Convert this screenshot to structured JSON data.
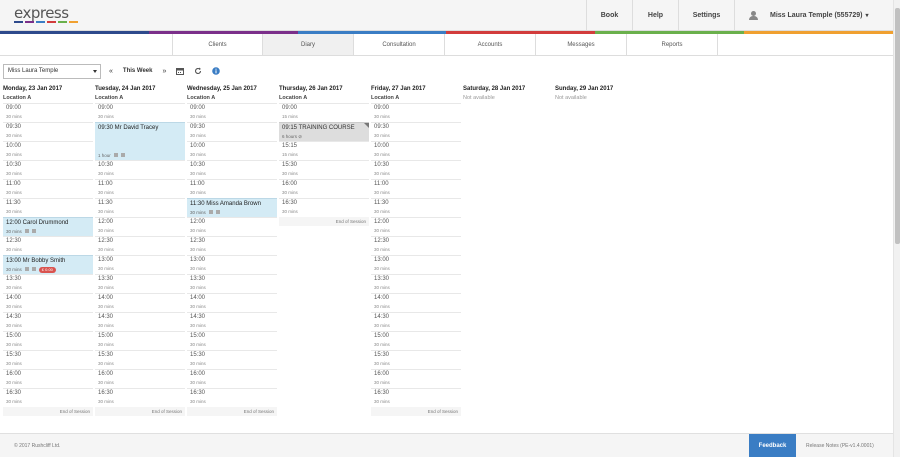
{
  "header": {
    "logo_text": "express",
    "logo_colors": [
      "#2e4a8c",
      "#7b2f8a",
      "#3a7dc4",
      "#d23c3c",
      "#6ab04c",
      "#f0a030"
    ],
    "nav": [
      {
        "label": "Book"
      },
      {
        "label": "Help"
      },
      {
        "label": "Settings"
      }
    ],
    "user": {
      "name": "Miss Laura Temple (555729)",
      "caret": "▾"
    }
  },
  "rainbow_colors": [
    "#2e4a8c",
    "#7b2f8a",
    "#3a7dc4",
    "#d23c3c",
    "#6ab04c",
    "#f0a030"
  ],
  "tabs": [
    {
      "label": "Clients",
      "active": false
    },
    {
      "label": "Diary",
      "active": true
    },
    {
      "label": "Consultation",
      "active": false
    },
    {
      "label": "Accounts",
      "active": false
    },
    {
      "label": "Messages",
      "active": false
    },
    {
      "label": "Reports",
      "active": false
    }
  ],
  "toolbar": {
    "practitioner": "Miss Laura Temple",
    "prev": "«",
    "week_label": "This Week",
    "next": "»",
    "calendar_icon": "calendar-icon",
    "refresh_icon": "refresh-icon",
    "info_icon": "info-icon"
  },
  "diary": {
    "days": [
      {
        "title": "Monday, 23 Jan 2017",
        "location": "Location A",
        "slots": [
          [
            "09:00",
            "30 mins"
          ],
          [
            "09:30",
            "30 mins"
          ],
          [
            "10:00",
            "30 mins"
          ],
          [
            "10:30",
            "30 mins"
          ],
          [
            "11:00",
            "30 mins"
          ],
          [
            "11:30",
            "30 mins"
          ],
          [
            "12:00 Carol Drummond",
            "30 mins",
            "appt"
          ],
          [
            "12:30",
            "30 mins"
          ],
          [
            "13:00 Mr Bobby Smith",
            "30 mins",
            "appt",
            "£ 0.00"
          ],
          [
            "13:30",
            "30 mins"
          ],
          [
            "14:00",
            "30 mins"
          ],
          [
            "14:30",
            "30 mins"
          ],
          [
            "15:00",
            "30 mins"
          ],
          [
            "15:30",
            "30 mins"
          ],
          [
            "16:00",
            "30 mins"
          ],
          [
            "16:30",
            "30 mins"
          ]
        ],
        "end": "End of Session"
      },
      {
        "title": "Tuesday, 24 Jan 2017",
        "location": "Location A",
        "slots": [
          [
            "09:00",
            "30 mins"
          ],
          [
            "09:30 Mr David Tracey",
            "1 hour",
            "appt2"
          ],
          [
            "10:30",
            "30 mins"
          ],
          [
            "11:00",
            "30 mins"
          ],
          [
            "11:30",
            "30 mins"
          ],
          [
            "12:00",
            "30 mins"
          ],
          [
            "12:30",
            "30 mins"
          ],
          [
            "13:00",
            "30 mins"
          ],
          [
            "13:30",
            "30 mins"
          ],
          [
            "14:00",
            "30 mins"
          ],
          [
            "14:30",
            "30 mins"
          ],
          [
            "15:00",
            "30 mins"
          ],
          [
            "15:30",
            "30 mins"
          ],
          [
            "16:00",
            "30 mins"
          ],
          [
            "16:30",
            "30 mins"
          ]
        ],
        "end": "End of Session"
      },
      {
        "title": "Wednesday, 25 Jan 2017",
        "location": "Location A",
        "slots": [
          [
            "09:00",
            "30 mins"
          ],
          [
            "09:30",
            "30 mins"
          ],
          [
            "10:00",
            "30 mins"
          ],
          [
            "10:30",
            "30 mins"
          ],
          [
            "11:00",
            "30 mins"
          ],
          [
            "11:30 Miss Amanda Brown",
            "30 mins",
            "appt"
          ],
          [
            "12:00",
            "30 mins"
          ],
          [
            "12:30",
            "30 mins"
          ],
          [
            "13:00",
            "30 mins"
          ],
          [
            "13:30",
            "30 mins"
          ],
          [
            "14:00",
            "30 mins"
          ],
          [
            "14:30",
            "30 mins"
          ],
          [
            "15:00",
            "30 mins"
          ],
          [
            "15:30",
            "30 mins"
          ],
          [
            "16:00",
            "30 mins"
          ],
          [
            "16:30",
            "30 mins"
          ]
        ],
        "end": "End of Session"
      },
      {
        "title": "Thursday, 26 Jan 2017",
        "location": "Location A",
        "slots": [
          [
            "09:00",
            "15 mins"
          ],
          [
            "09:15 TRAINING COURSE",
            "6 hours",
            "course"
          ],
          [
            "15:15",
            "15 mins"
          ],
          [
            "15:30",
            "30 mins"
          ],
          [
            "16:00",
            "30 mins"
          ],
          [
            "16:30",
            "30 mins"
          ]
        ],
        "end": "End of Session"
      },
      {
        "title": "Friday, 27 Jan 2017",
        "location": "Location A",
        "slots": [
          [
            "09:00",
            "30 mins"
          ],
          [
            "09:30",
            "30 mins"
          ],
          [
            "10:00",
            "30 mins"
          ],
          [
            "10:30",
            "30 mins"
          ],
          [
            "11:00",
            "30 mins"
          ],
          [
            "11:30",
            "30 mins"
          ],
          [
            "12:00",
            "30 mins"
          ],
          [
            "12:30",
            "30 mins"
          ],
          [
            "13:00",
            "30 mins"
          ],
          [
            "13:30",
            "30 mins"
          ],
          [
            "14:00",
            "30 mins"
          ],
          [
            "14:30",
            "30 mins"
          ],
          [
            "15:00",
            "30 mins"
          ],
          [
            "15:30",
            "30 mins"
          ],
          [
            "16:00",
            "30 mins"
          ],
          [
            "16:30",
            "30 mins"
          ]
        ],
        "end": "End of Session"
      },
      {
        "title": "Saturday, 28 Jan 2017",
        "unavailable": "Not available"
      },
      {
        "title": "Sunday, 29 Jan 2017",
        "unavailable": "Not available"
      }
    ]
  },
  "footer": {
    "copyright": "© 2017 Rushcliff Ltd.",
    "feedback": "Feedback",
    "release": "Release Notes (PE-v1.4.0001)"
  }
}
